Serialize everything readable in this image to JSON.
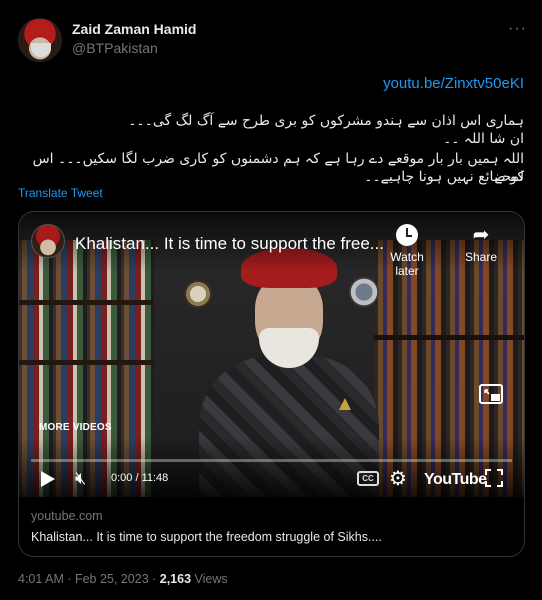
{
  "author": {
    "name": "Zaid Zaman Hamid",
    "handle": "@BTPakistan"
  },
  "more_icon": "more-horizontal-icon",
  "tweet": {
    "link": "youtu.be/Zinxtv50eKI",
    "lines": [
      "ہماری اس اذان سے ہندو مشرکوں کو بری طرح سے آگ لگ گی۔۔۔",
      "ان شا اللہ ۔۔",
      "اللہ ہمیں بار بار موقعے دے رہا ہے کہ ہم دشمنوں کو کاری ضرب لگا سکیں۔۔۔ اس لمحے",
      "کو ضائع نہیں ہونا چاہیے۔۔"
    ],
    "translate_label": "Translate Tweet"
  },
  "video": {
    "title": "Khalistan... It is time to support the free...",
    "watch_later_label": "Watch later",
    "share_label": "Share",
    "more_videos_label": "MORE VIDEOS",
    "time": "0:00 / 11:48",
    "progress": 0,
    "cc_label": "CC",
    "youtube_label": "YouTube"
  },
  "card": {
    "domain": "youtube.com",
    "title": "Khalistan... It is time to support the freedom struggle of Sikhs...."
  },
  "footer": {
    "time": "4:01 AM · Feb 25, 2023 · ",
    "views_count": "2,163",
    "views_label": " Views"
  },
  "colors": {
    "accent": "#1d9bf0",
    "background": "#000000",
    "muted": "#71767b"
  }
}
